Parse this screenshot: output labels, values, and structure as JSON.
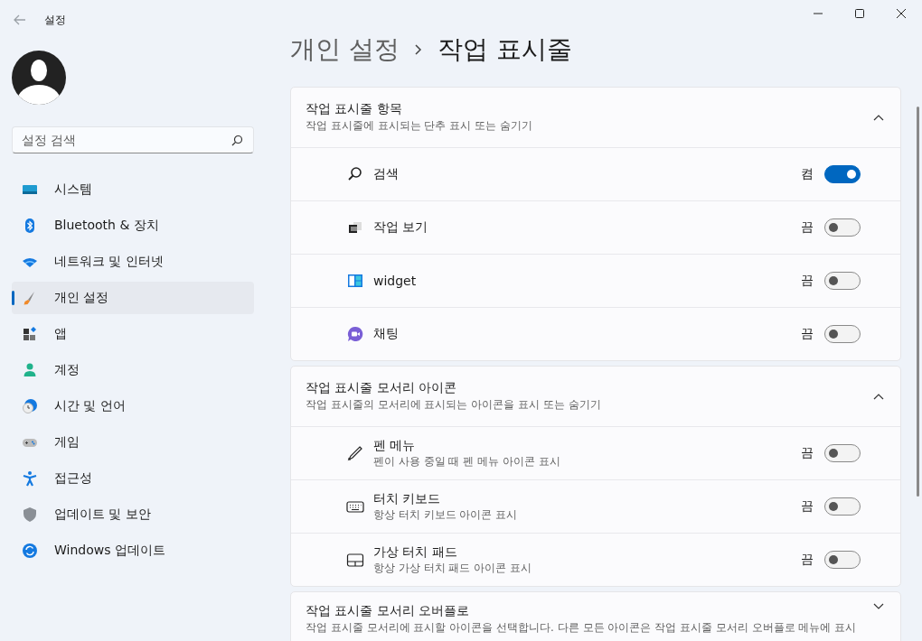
{
  "window": {
    "title": "설정"
  },
  "sidebar": {
    "search": {
      "placeholder": "설정 검색"
    },
    "items": [
      {
        "label": "시스템",
        "selected": false
      },
      {
        "label": "Bluetooth & 장치",
        "selected": false
      },
      {
        "label": "네트워크 및 인터넷",
        "selected": false
      },
      {
        "label": "개인 설정",
        "selected": true
      },
      {
        "label": "앱",
        "selected": false
      },
      {
        "label": "계정",
        "selected": false
      },
      {
        "label": "시간 및 언어",
        "selected": false
      },
      {
        "label": "게임",
        "selected": false
      },
      {
        "label": "접근성",
        "selected": false
      },
      {
        "label": "업데이트 및 보안",
        "selected": false
      },
      {
        "label": "Windows 업데이트",
        "selected": false
      }
    ]
  },
  "breadcrumb": [
    "개인 설정",
    "작업 표시줄"
  ],
  "sections": [
    {
      "title": "작업 표시줄 항목",
      "subtitle": "작업 표시줄에 표시되는 단추 표시 또는 숨기기",
      "expanded": true,
      "items": [
        {
          "label": "검색",
          "on": true,
          "state_text": "켬"
        },
        {
          "label": "작업 보기",
          "on": false,
          "state_text": "끔"
        },
        {
          "label": "widget",
          "on": false,
          "state_text": "끔"
        },
        {
          "label": "채팅",
          "on": false,
          "state_text": "끔"
        }
      ]
    },
    {
      "title": "작업 표시줄 모서리 아이콘",
      "subtitle": "작업 표시줄의 모서리에 표시되는 아이콘을 표시 또는 숨기기",
      "expanded": true,
      "items": [
        {
          "label": "펜 메뉴",
          "description": "펜이 사용 중일 때 펜 메뉴 아이콘 표시",
          "on": false,
          "state_text": "끔"
        },
        {
          "label": "터치 키보드",
          "description": "항상 터치 키보드 아이콘 표시",
          "on": false,
          "state_text": "끔"
        },
        {
          "label": "가상 터치 패드",
          "description": "항상 가상 터치 패드 아이콘 표시",
          "on": false,
          "state_text": "끔"
        }
      ]
    },
    {
      "title": "작업 표시줄 모서리 오버플로",
      "subtitle": "작업 표시줄 모서리에 표시할 아이콘을 선택합니다. 다른 모든 아이콘은 작업 표시줄 모서리 오버플로 메뉴에 표시",
      "expanded": false
    }
  ]
}
